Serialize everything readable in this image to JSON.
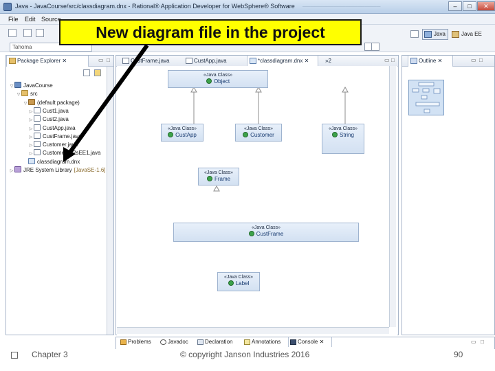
{
  "window": {
    "title": "Java - JavaCourse/src/classdiagram.dnx - Rational® Application Developer for WebSphere® Software",
    "minimize": "–",
    "maximize": "□",
    "close": "✕"
  },
  "menu": {
    "items": [
      "File",
      "Edit",
      "Source"
    ]
  },
  "toolbar": {
    "font_combo": "Tahoma",
    "perspectives": [
      {
        "label": "Java",
        "active": true
      },
      {
        "label": "Java EE",
        "active": false
      }
    ]
  },
  "package_explorer": {
    "tab": "Package Explorer",
    "tree": [
      {
        "label": "JavaCourse",
        "type": "project",
        "twisty": "▽"
      },
      {
        "label": "src",
        "type": "folder",
        "twisty": "▽"
      },
      {
        "label": "(default package)",
        "type": "pkg",
        "twisty": "▽"
      },
      {
        "label": "Cust1.java",
        "type": "java",
        "twisty": "▷"
      },
      {
        "label": "Cust2.java",
        "type": "java",
        "twisty": "▷"
      },
      {
        "label": "CustApp.java",
        "type": "java",
        "twisty": "▷"
      },
      {
        "label": "CustFrame.java",
        "type": "java",
        "twisty": "▷"
      },
      {
        "label": "Customer.java",
        "type": "java",
        "twisty": "▷"
      },
      {
        "label": "CustomerBc2sEE1.java",
        "type": "java",
        "twisty": "▷"
      },
      {
        "label": "classdiagram.dnx",
        "type": "dnx",
        "twisty": ""
      },
      {
        "label": "JRE System Library",
        "suffix": "[JavaSE-1.6]",
        "type": "lib",
        "twisty": "▷"
      }
    ]
  },
  "editor": {
    "tabs": [
      "CustFrame.java",
      "CustApp.java",
      "*classdiagram.dnx",
      "»2"
    ]
  },
  "diagram": {
    "stereotype": "«Java Class»",
    "nodes": [
      {
        "id": "object",
        "name": "Object"
      },
      {
        "id": "custapp",
        "name": "CustApp"
      },
      {
        "id": "customer",
        "name": "Customer"
      },
      {
        "id": "string",
        "name": "String"
      },
      {
        "id": "frame",
        "name": "Frame"
      },
      {
        "id": "custframe",
        "name": "CustFrame"
      },
      {
        "id": "label",
        "name": "Label"
      }
    ]
  },
  "outline": {
    "tab": "Outline"
  },
  "bottom_views": {
    "tabs": [
      "Problems",
      "Javadoc",
      "Declaration",
      "Annotations",
      "Console"
    ]
  },
  "callout": {
    "text": "New diagram file in the project",
    "color": "#ffff00"
  },
  "footer": {
    "chapter": "Chapter 3",
    "copyright": "© copyright Janson Industries 2016",
    "page_number": "90"
  }
}
